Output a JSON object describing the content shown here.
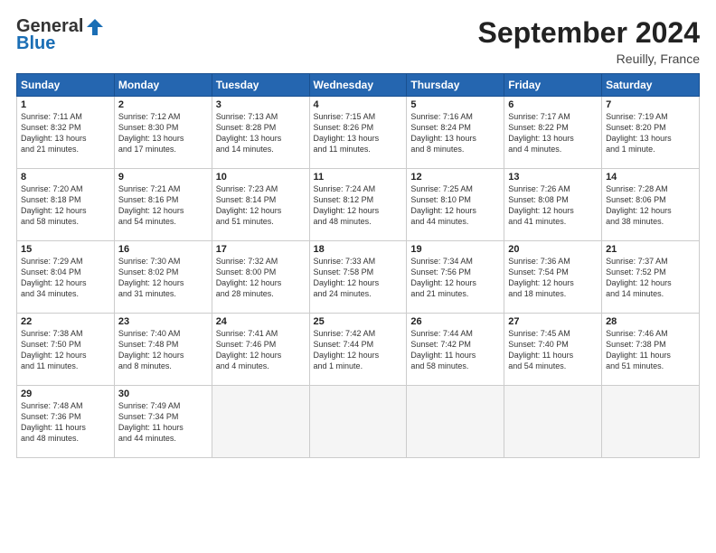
{
  "header": {
    "logo_general": "General",
    "logo_blue": "Blue",
    "month_title": "September 2024",
    "location": "Reuilly, France"
  },
  "weekdays": [
    "Sunday",
    "Monday",
    "Tuesday",
    "Wednesday",
    "Thursday",
    "Friday",
    "Saturday"
  ],
  "weeks": [
    [
      {
        "day": "1",
        "info": "Sunrise: 7:11 AM\nSunset: 8:32 PM\nDaylight: 13 hours\nand 21 minutes."
      },
      {
        "day": "2",
        "info": "Sunrise: 7:12 AM\nSunset: 8:30 PM\nDaylight: 13 hours\nand 17 minutes."
      },
      {
        "day": "3",
        "info": "Sunrise: 7:13 AM\nSunset: 8:28 PM\nDaylight: 13 hours\nand 14 minutes."
      },
      {
        "day": "4",
        "info": "Sunrise: 7:15 AM\nSunset: 8:26 PM\nDaylight: 13 hours\nand 11 minutes."
      },
      {
        "day": "5",
        "info": "Sunrise: 7:16 AM\nSunset: 8:24 PM\nDaylight: 13 hours\nand 8 minutes."
      },
      {
        "day": "6",
        "info": "Sunrise: 7:17 AM\nSunset: 8:22 PM\nDaylight: 13 hours\nand 4 minutes."
      },
      {
        "day": "7",
        "info": "Sunrise: 7:19 AM\nSunset: 8:20 PM\nDaylight: 13 hours\nand 1 minute."
      }
    ],
    [
      {
        "day": "8",
        "info": "Sunrise: 7:20 AM\nSunset: 8:18 PM\nDaylight: 12 hours\nand 58 minutes."
      },
      {
        "day": "9",
        "info": "Sunrise: 7:21 AM\nSunset: 8:16 PM\nDaylight: 12 hours\nand 54 minutes."
      },
      {
        "day": "10",
        "info": "Sunrise: 7:23 AM\nSunset: 8:14 PM\nDaylight: 12 hours\nand 51 minutes."
      },
      {
        "day": "11",
        "info": "Sunrise: 7:24 AM\nSunset: 8:12 PM\nDaylight: 12 hours\nand 48 minutes."
      },
      {
        "day": "12",
        "info": "Sunrise: 7:25 AM\nSunset: 8:10 PM\nDaylight: 12 hours\nand 44 minutes."
      },
      {
        "day": "13",
        "info": "Sunrise: 7:26 AM\nSunset: 8:08 PM\nDaylight: 12 hours\nand 41 minutes."
      },
      {
        "day": "14",
        "info": "Sunrise: 7:28 AM\nSunset: 8:06 PM\nDaylight: 12 hours\nand 38 minutes."
      }
    ],
    [
      {
        "day": "15",
        "info": "Sunrise: 7:29 AM\nSunset: 8:04 PM\nDaylight: 12 hours\nand 34 minutes."
      },
      {
        "day": "16",
        "info": "Sunrise: 7:30 AM\nSunset: 8:02 PM\nDaylight: 12 hours\nand 31 minutes."
      },
      {
        "day": "17",
        "info": "Sunrise: 7:32 AM\nSunset: 8:00 PM\nDaylight: 12 hours\nand 28 minutes."
      },
      {
        "day": "18",
        "info": "Sunrise: 7:33 AM\nSunset: 7:58 PM\nDaylight: 12 hours\nand 24 minutes."
      },
      {
        "day": "19",
        "info": "Sunrise: 7:34 AM\nSunset: 7:56 PM\nDaylight: 12 hours\nand 21 minutes."
      },
      {
        "day": "20",
        "info": "Sunrise: 7:36 AM\nSunset: 7:54 PM\nDaylight: 12 hours\nand 18 minutes."
      },
      {
        "day": "21",
        "info": "Sunrise: 7:37 AM\nSunset: 7:52 PM\nDaylight: 12 hours\nand 14 minutes."
      }
    ],
    [
      {
        "day": "22",
        "info": "Sunrise: 7:38 AM\nSunset: 7:50 PM\nDaylight: 12 hours\nand 11 minutes."
      },
      {
        "day": "23",
        "info": "Sunrise: 7:40 AM\nSunset: 7:48 PM\nDaylight: 12 hours\nand 8 minutes."
      },
      {
        "day": "24",
        "info": "Sunrise: 7:41 AM\nSunset: 7:46 PM\nDaylight: 12 hours\nand 4 minutes."
      },
      {
        "day": "25",
        "info": "Sunrise: 7:42 AM\nSunset: 7:44 PM\nDaylight: 12 hours\nand 1 minute."
      },
      {
        "day": "26",
        "info": "Sunrise: 7:44 AM\nSunset: 7:42 PM\nDaylight: 11 hours\nand 58 minutes."
      },
      {
        "day": "27",
        "info": "Sunrise: 7:45 AM\nSunset: 7:40 PM\nDaylight: 11 hours\nand 54 minutes."
      },
      {
        "day": "28",
        "info": "Sunrise: 7:46 AM\nSunset: 7:38 PM\nDaylight: 11 hours\nand 51 minutes."
      }
    ],
    [
      {
        "day": "29",
        "info": "Sunrise: 7:48 AM\nSunset: 7:36 PM\nDaylight: 11 hours\nand 48 minutes."
      },
      {
        "day": "30",
        "info": "Sunrise: 7:49 AM\nSunset: 7:34 PM\nDaylight: 11 hours\nand 44 minutes."
      },
      {
        "day": "",
        "info": ""
      },
      {
        "day": "",
        "info": ""
      },
      {
        "day": "",
        "info": ""
      },
      {
        "day": "",
        "info": ""
      },
      {
        "day": "",
        "info": ""
      }
    ]
  ]
}
